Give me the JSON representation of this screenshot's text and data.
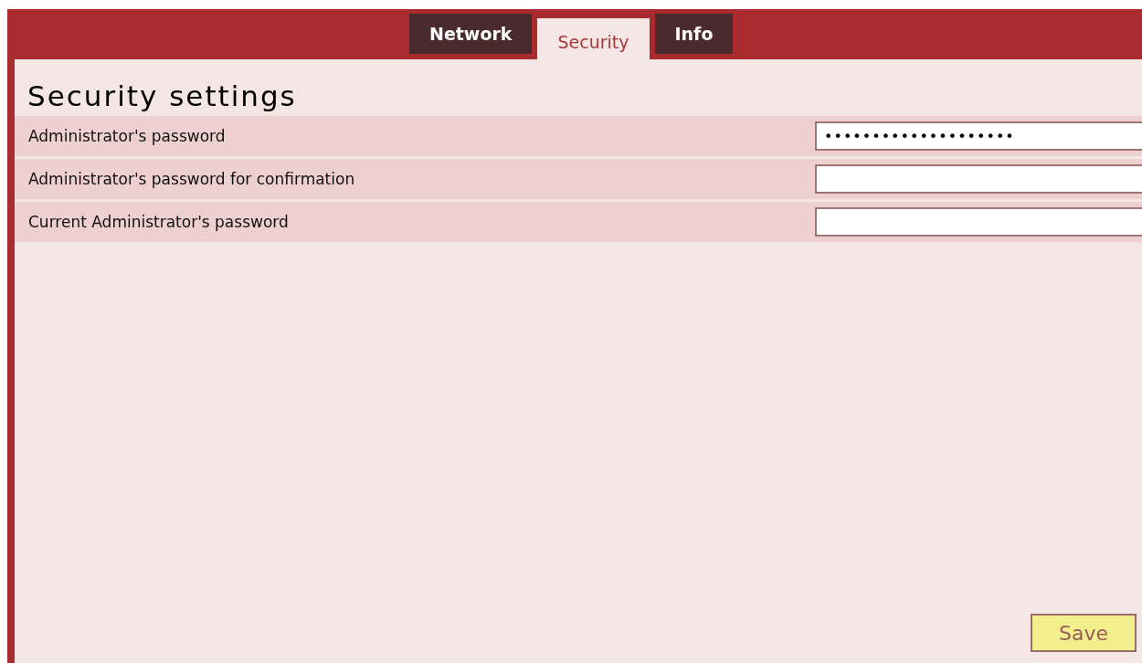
{
  "tabs": [
    {
      "label": "Network",
      "selected": false
    },
    {
      "label": "Security",
      "selected": true
    },
    {
      "label": "Info",
      "selected": false
    }
  ],
  "heading": "Security settings",
  "fields": [
    {
      "label": "Administrator's password",
      "value": "••••••••••••••••••••"
    },
    {
      "label": "Administrator's password for confirmation"
    },
    {
      "label": "Current Administrator's password"
    }
  ],
  "save_button": "Save"
}
